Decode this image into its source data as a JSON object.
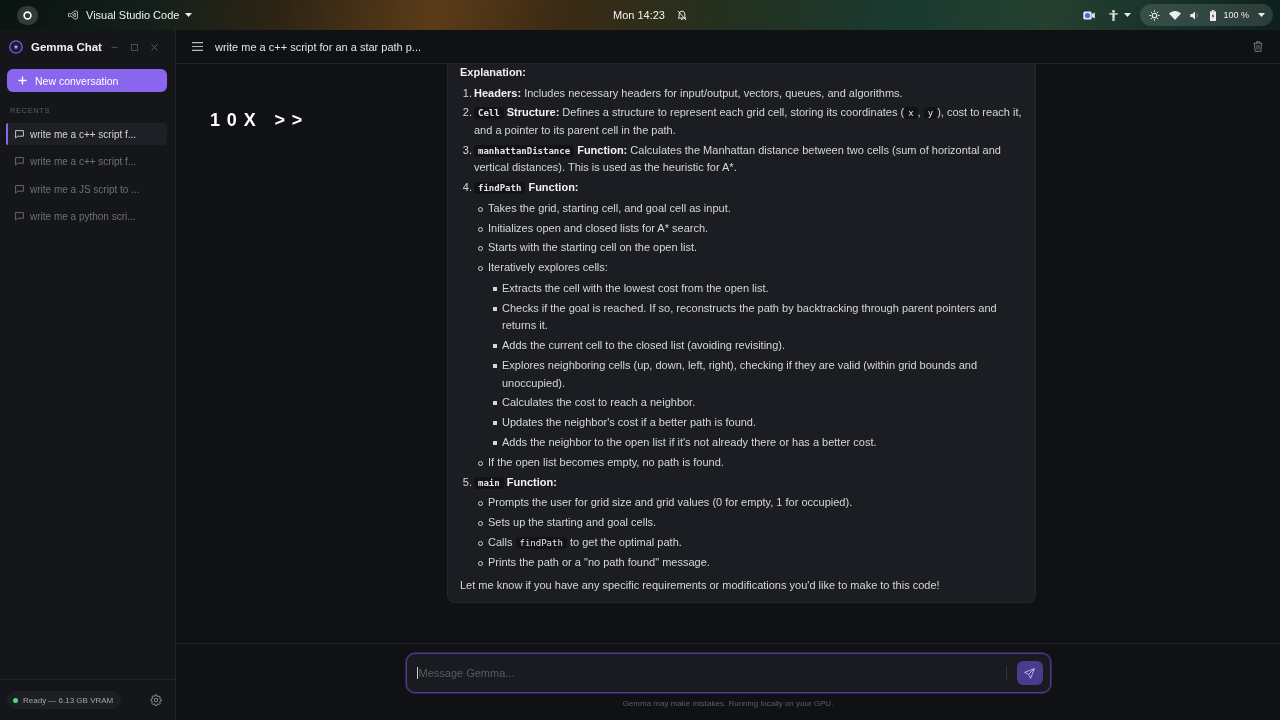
{
  "top_bar": {
    "app_name": "Visual Studio Code",
    "clock": "Mon 14:23",
    "battery": "100 %"
  },
  "sidebar": {
    "title": "Gemma Chat",
    "new_button": "New conversation",
    "section_label": "RECENTS",
    "items": [
      {
        "label": "write me a c++ script f...",
        "selected": true
      },
      {
        "label": "write me a c++ script f...",
        "selected": false
      },
      {
        "label": "write me a JS script to ...",
        "selected": false
      },
      {
        "label": "write me a python scri...",
        "selected": false
      }
    ],
    "status": "Ready — 6.13 GB VRAM"
  },
  "chat_header": {
    "title": "write me a c++ script for an a star path p..."
  },
  "speed_overlay": "10X >>",
  "message": {
    "heading": "Explanation:",
    "items": [
      {
        "number": "1.",
        "segments": [
          {
            "kind": "bold",
            "text": "Headers:"
          },
          {
            "kind": "text",
            "text": " Includes necessary headers for input/output, vectors, queues, and algorithms."
          }
        ]
      },
      {
        "number": "2.",
        "segments": [
          {
            "kind": "boldcode",
            "text": "Cell"
          },
          {
            "kind": "bold",
            "text": " Structure:"
          },
          {
            "kind": "text",
            "text": " Defines a structure to represent each grid cell, storing its coordinates ("
          },
          {
            "kind": "code",
            "text": "x"
          },
          {
            "kind": "text",
            "text": ", "
          },
          {
            "kind": "code",
            "text": "y"
          },
          {
            "kind": "text",
            "text": "), cost to reach it, and a pointer to its parent cell in the path."
          }
        ]
      },
      {
        "number": "3.",
        "segments": [
          {
            "kind": "boldcode",
            "text": "manhattanDistance"
          },
          {
            "kind": "bold",
            "text": " Function:"
          },
          {
            "kind": "text",
            "text": " Calculates the Manhattan distance between two cells (sum of horizontal and vertical distances). This is used as the heuristic for A*."
          }
        ]
      },
      {
        "number": "4.",
        "segments": [
          {
            "kind": "boldcode",
            "text": "findPath"
          },
          {
            "kind": "bold",
            "text": " Function:"
          }
        ],
        "children": [
          {
            "text": "Takes the grid, starting cell, and goal cell as input."
          },
          {
            "text": "Initializes open and closed lists for A* search."
          },
          {
            "text": "Starts with the starting cell on the open list."
          },
          {
            "text": "Iteratively explores cells:",
            "children": [
              {
                "text": "Extracts the cell with the lowest cost from the open list."
              },
              {
                "text": "Checks if the goal is reached. If so, reconstructs the path by backtracking through parent pointers and returns it."
              },
              {
                "text": "Adds the current cell to the closed list (avoiding revisiting)."
              },
              {
                "text": "Explores neighboring cells (up, down, left, right), checking if they are valid (within grid bounds and unoccupied)."
              },
              {
                "text": "Calculates the cost to reach a neighbor."
              },
              {
                "text": "Updates the neighbor's cost if a better path is found."
              },
              {
                "text": "Adds the neighbor to the open list if it's not already there or has a better cost."
              }
            ]
          },
          {
            "text": "If the open list becomes empty, no path is found."
          }
        ]
      },
      {
        "number": "5.",
        "segments": [
          {
            "kind": "boldcode",
            "text": "main"
          },
          {
            "kind": "bold",
            "text": " Function:"
          }
        ],
        "children": [
          {
            "text": "Prompts the user for grid size and grid values (0 for empty, 1 for occupied)."
          },
          {
            "text": "Sets up the starting and goal cells."
          },
          {
            "segments": [
              {
                "kind": "text",
                "text": "Calls "
              },
              {
                "kind": "code",
                "text": "findPath"
              },
              {
                "kind": "text",
                "text": " to get the optimal path."
              }
            ]
          },
          {
            "text": "Prints the path or a \"no path found\" message."
          }
        ]
      }
    ],
    "closing": "Let me know if you have any specific requirements or modifications you'd like to make to this code!"
  },
  "composer": {
    "placeholder": "Message Gemma...",
    "focused": true,
    "disclaimer": "Gemma may make mistakes. Running locally on your GPU."
  }
}
